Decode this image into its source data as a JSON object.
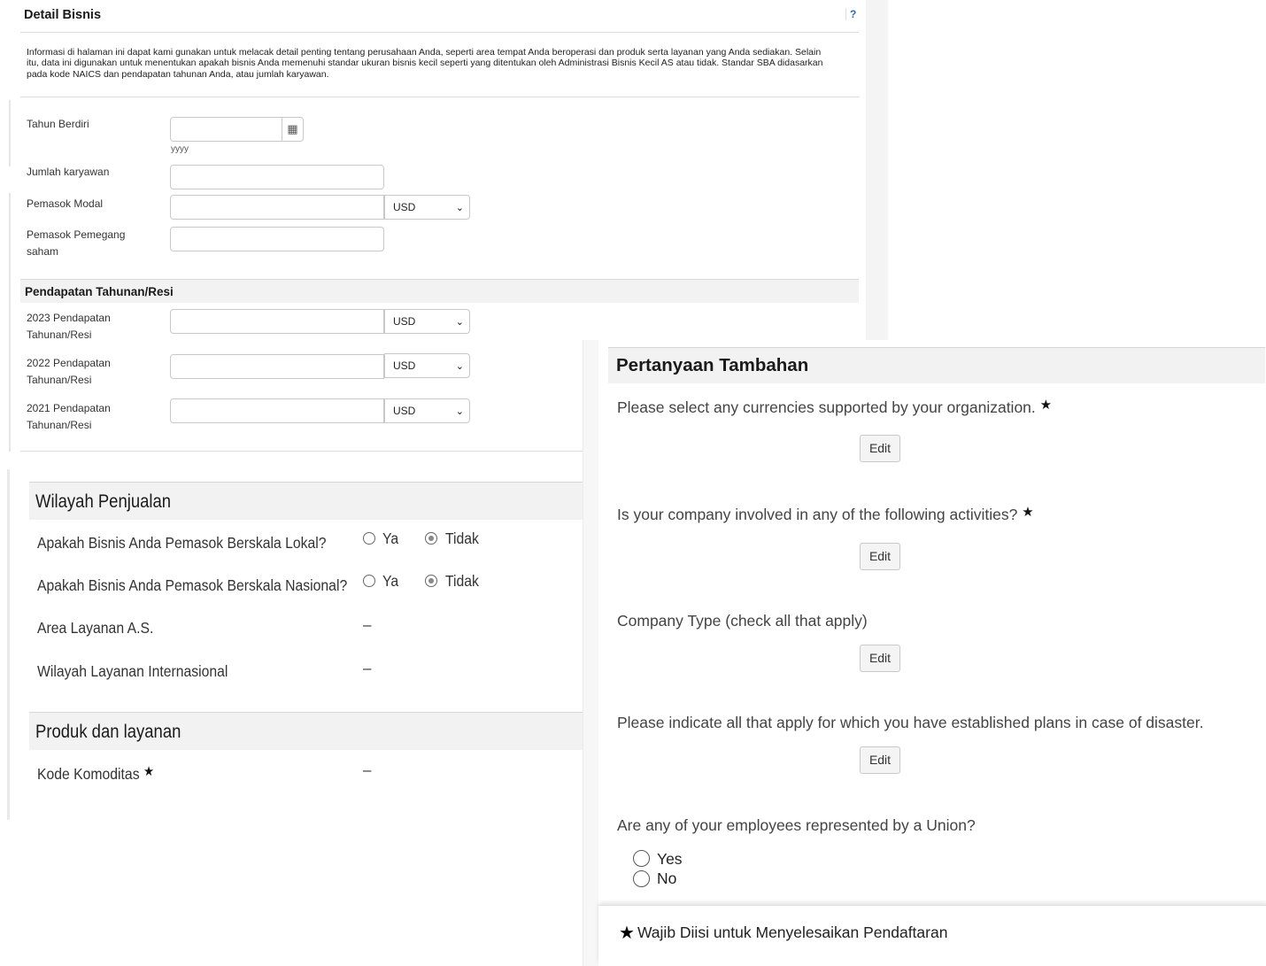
{
  "detail_bisnis": {
    "title": "Detail Bisnis",
    "help": "?",
    "intro": "Informasi di halaman ini dapat kami gunakan untuk melacak detail penting tentang perusahaan Anda, seperti area tempat Anda beroperasi dan produk serta layanan yang Anda sediakan. Selain itu, data ini digunakan untuk menentukan apakah bisnis Anda memenuhi standar ukuran bisnis kecil seperti yang ditentukan oleh Administrasi Bisnis Kecil AS atau tidak. Standar SBA didasarkan pada kode NAICS dan pendapatan tahunan Anda, atau jumlah karyawan.",
    "fields": {
      "tahun_berdiri": {
        "label": "Tahun Berdiri",
        "value": "",
        "hint": "yyyy",
        "icon": "calendar-icon"
      },
      "jumlah_karyawan": {
        "label": "Jumlah karyawan",
        "value": ""
      },
      "pemasok_modal": {
        "label": "Pemasok Modal",
        "value": "",
        "currency": "USD"
      },
      "pemasok_pemegang_saham": {
        "label": "Pemasok Pemegang saham",
        "value": ""
      }
    },
    "revenue_section": {
      "title": "Pendapatan Tahunan/Resi",
      "rows": [
        {
          "label": "2023 Pendapatan Tahunan/Resi",
          "value": "",
          "currency": "USD"
        },
        {
          "label": "2022 Pendapatan Tahunan/Resi",
          "value": "",
          "currency": "USD"
        },
        {
          "label": "2021 Pendapatan Tahunan/Resi",
          "value": "",
          "currency": "USD"
        }
      ]
    }
  },
  "wilayah_penjualan": {
    "title": "Wilayah Penjualan",
    "questions": [
      {
        "label": "Apakah Bisnis Anda Pemasok Berskala Lokal?",
        "options": [
          "Ya",
          "Tidak"
        ],
        "selected": "Tidak"
      },
      {
        "label": "Apakah Bisnis Anda Pemasok Berskala Nasional?",
        "options": [
          "Ya",
          "Tidak"
        ],
        "selected": "Tidak"
      }
    ],
    "area_layanan_as": {
      "label": "Area Layanan A.S.",
      "value": "–"
    },
    "wilayah_internasional": {
      "label": "Wilayah Layanan Internasional",
      "value": "–"
    }
  },
  "produk_layanan": {
    "title": "Produk dan layanan",
    "kode_komoditas": {
      "label": "Kode Komoditas",
      "value": "–",
      "required_mark": "★"
    }
  },
  "pertanyaan_tambahan": {
    "title": "Pertanyaan Tambahan",
    "questions": [
      {
        "text": "Please select any currencies supported by your organization.",
        "required_mark": "★",
        "button": "Edit"
      },
      {
        "text": "Is your company involved in any of the following activities?",
        "required_mark": "★",
        "button": "Edit"
      },
      {
        "text": "Company Type (check all that apply)",
        "button": "Edit"
      },
      {
        "text": "Please indicate all that apply for which you have established plans in case of disaster.",
        "button": "Edit"
      }
    ],
    "union_question": {
      "text": "Are any of your employees represented by a Union?",
      "options": [
        "Yes",
        "No"
      ]
    },
    "footer": {
      "star": "★",
      "text": "Wajib Diisi untuk Menyelesaikan Pendaftaran"
    }
  }
}
